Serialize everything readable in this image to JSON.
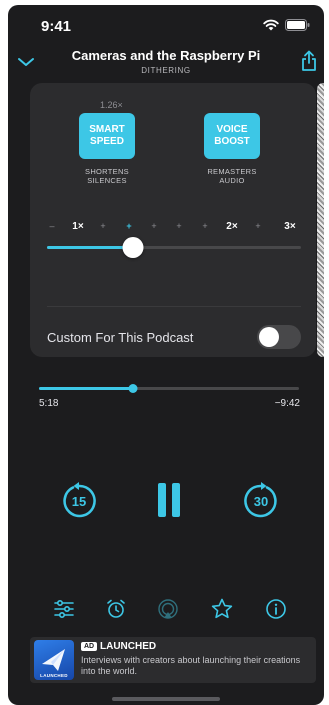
{
  "status_bar": {
    "time": "9:41"
  },
  "header": {
    "episode_title": "Cameras and the Raspberry Pi",
    "podcast_name": "DITHERING"
  },
  "effects": {
    "speed_value": "1.26×",
    "smart_speed": {
      "label": "SMART\nSPEED",
      "caption": "SHORTENS\nSILENCES",
      "enabled": true
    },
    "voice_boost": {
      "label": "VOICE\nBOOST",
      "caption": "REMASTERS\nAUDIO",
      "enabled": true
    },
    "speed_scale": [
      "–",
      "1×",
      "+",
      "+",
      "+",
      "+",
      "+",
      "2×",
      "+",
      "3×"
    ],
    "speed_position": 0.34,
    "custom_label": "Custom For This Podcast",
    "custom_enabled": false
  },
  "playback": {
    "elapsed": "5:18",
    "remaining": "−9:42",
    "progress": 0.36,
    "skip_back": "15",
    "skip_forward": "30"
  },
  "toolbar": {
    "items": [
      "effects-icon",
      "sleep-timer-icon",
      "airplay-icon",
      "star-icon",
      "info-icon"
    ]
  },
  "ad": {
    "badge": "AD",
    "title": "LAUNCHED",
    "description": "Interviews with creators about launching their creations into the world.",
    "art_caption": "LAUNCHED"
  },
  "colors": {
    "accent": "#3dc7e6",
    "background": "#1c1c1e",
    "card": "#2c2c2e"
  }
}
